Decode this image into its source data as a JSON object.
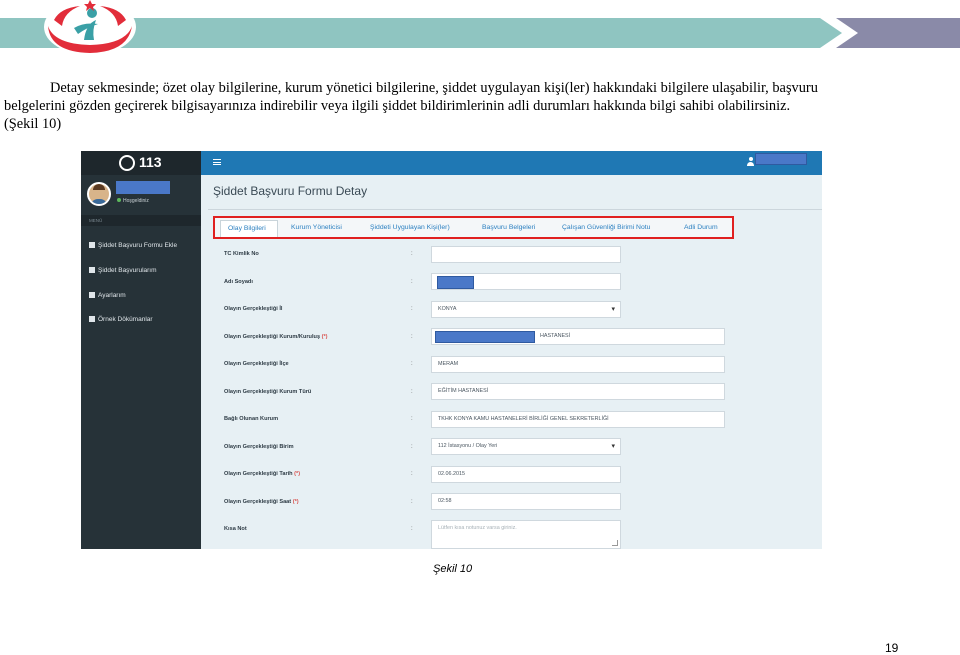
{
  "paragraph": {
    "line1": "Detay sekmesinde; özet olay bilgilerine, kurum yönetici bilgilerine, şiddet uygulayan kişi(ler) hakkındaki bilgilere ulaşabilir, başvuru",
    "line2": "belgelerini gözden geçirerek bilgisayarınıza indirebilir veya ilgili şiddet bildirimlerinin adli durumları hakkında bilgi sahibi olabilirsiniz.",
    "line3": "(Şekil 10)"
  },
  "screenshot": {
    "brand": "113",
    "welcome": "Hoşgeldiniz",
    "menu_header": "MENÜ",
    "sidebar_items": [
      {
        "label": "Şiddet Başvuru Formu Ekle",
        "icon": "edit-icon"
      },
      {
        "label": "Şiddet Başvurularım",
        "icon": "save-icon"
      },
      {
        "label": "Ayarlarım",
        "icon": "wrench-icon"
      },
      {
        "label": "Örnek Dökümanlar",
        "icon": "wrench-icon"
      }
    ],
    "page_title": "Şiddet Başvuru Formu Detay",
    "tabs": [
      "Olay Bilgileri",
      "Kurum Yöneticisi",
      "Şiddeti Uygulayan Kişi(ler)",
      "Başvuru Belgeleri",
      "Çalışan Güvenliği Birimi Notu",
      "Adli Durum"
    ],
    "active_tab": "Olay Bilgileri",
    "fields": [
      {
        "label": "TC Kimlik No",
        "value": ""
      },
      {
        "label": "Adı Soyadı",
        "value": ""
      },
      {
        "label": "Olayın Gerçekleştiği İl",
        "value": "KONYA"
      },
      {
        "label": "Olayın Gerçekleştiği Kurum/Kuruluş",
        "required": "(*)",
        "value": "HASTANESİ"
      },
      {
        "label": "Olayın Gerçekleştiği İlçe",
        "value": "MERAM"
      },
      {
        "label": "Olayın Gerçekleştiği Kurum Türü",
        "value": "EĞİTİM HASTANESİ"
      },
      {
        "label": "Bağlı Olunan Kurum",
        "value": "TKHK KONYA KAMU HASTANELERİ BİRLİĞİ GENEL SEKRETERLİĞİ"
      },
      {
        "label": "Olayın Gerçekleştiği Birim",
        "value": "112 İstasyonu / Olay Yeri"
      },
      {
        "label": "Olayın Gerçekleştiği Tarih",
        "required": "(*)",
        "value": "02.06.2015"
      },
      {
        "label": "Olayın Gerçekleştiği Saat",
        "required": "(*)",
        "value": "02:58"
      },
      {
        "label": "Kısa Not",
        "value": "",
        "placeholder": "Lütfen kısa notunuz varsa giriniz."
      }
    ],
    "colon": ":"
  },
  "caption": "Şekil 10",
  "page_number": "19",
  "colors": {
    "header_teal": "#8fc5c1",
    "header_purple": "#8a8aa8",
    "tab_highlight": "#e02020",
    "topbar": "#1f78b4",
    "sidebar": "#263238"
  }
}
